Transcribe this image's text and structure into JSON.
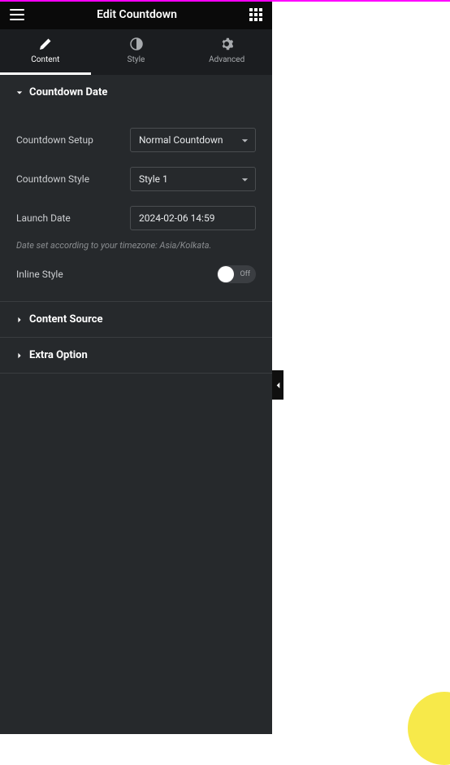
{
  "header": {
    "title": "Edit Countdown"
  },
  "tabs": {
    "content": "Content",
    "style": "Style",
    "advanced": "Advanced"
  },
  "sections": {
    "countdown_date": {
      "title": "Countdown Date",
      "fields": {
        "setup_label": "Countdown Setup",
        "setup_value": "Normal Countdown",
        "style_label": "Countdown Style",
        "style_value": "Style 1",
        "launch_label": "Launch Date",
        "launch_value": "2024-02-06 14:59",
        "timezone_note": "Date set according to your timezone: Asia/Kolkata.",
        "inline_label": "Inline Style",
        "toggle_off": "Off"
      }
    },
    "content_source": {
      "title": "Content Source"
    },
    "extra_option": {
      "title": "Extra Option"
    }
  }
}
